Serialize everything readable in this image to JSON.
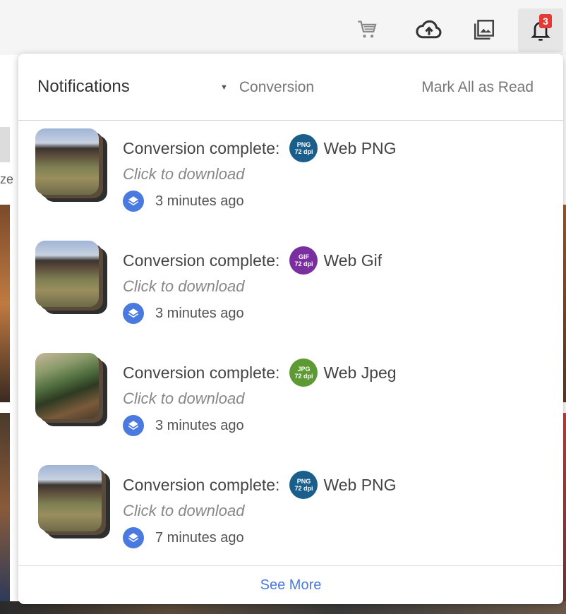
{
  "toolbar": {
    "icons": [
      "cart-icon",
      "cloud-upload-icon",
      "gallery-icon",
      "bell-icon"
    ],
    "notification_count": "3"
  },
  "background": {
    "partial_text": "ze"
  },
  "panel": {
    "title": "Notifications",
    "filter_label": "Conversion",
    "mark_all_label": "Mark All as Read",
    "see_more_label": "See More"
  },
  "notifications": [
    {
      "message": "Conversion complete:",
      "format_code": "PNG",
      "format_dpi": "72 dpi",
      "format_color": "#1a5f8c",
      "format_name": "Web PNG",
      "action": "Click to download",
      "time": "3 minutes ago"
    },
    {
      "message": "Conversion complete:",
      "format_code": "GIF",
      "format_dpi": "72 dpi",
      "format_color": "#7a2fa0",
      "format_name": "Web Gif",
      "action": "Click to download",
      "time": "3 minutes ago"
    },
    {
      "message": "Conversion complete:",
      "format_code": "JPG",
      "format_dpi": "72 dpi",
      "format_color": "#5e9a34",
      "format_name": "Web Jpeg",
      "action": "Click to download",
      "time": "3 minutes ago"
    },
    {
      "message": "Conversion complete:",
      "format_code": "PNG",
      "format_dpi": "72 dpi",
      "format_color": "#1a5f8c",
      "format_name": "Web PNG",
      "action": "Click to download",
      "time": "7 minutes ago"
    }
  ]
}
